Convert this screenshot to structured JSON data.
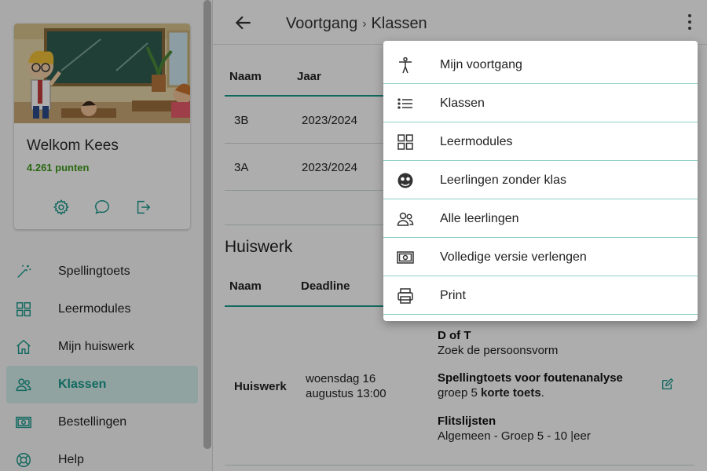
{
  "sidebar": {
    "welcome": "Welkom Kees",
    "points": "4.261 punten",
    "card_icons": [
      "gear-icon",
      "chat-icon",
      "logout-icon"
    ],
    "items": [
      {
        "label": "Spellingtoets",
        "icon": "magic-wand-icon"
      },
      {
        "label": "Leermodules",
        "icon": "grid-icon"
      },
      {
        "label": "Mijn huiswerk",
        "icon": "home-icon"
      },
      {
        "label": "Klassen",
        "icon": "people-icon",
        "active": true
      },
      {
        "label": "Bestellingen",
        "icon": "cash-icon"
      },
      {
        "label": "Help",
        "icon": "lifebuoy-icon"
      }
    ]
  },
  "header": {
    "breadcrumb": [
      "Voortgang",
      "Klassen"
    ],
    "separator": "›"
  },
  "classes_table": {
    "headers": [
      "Naam",
      "Jaar"
    ],
    "rows": [
      {
        "naam": "3B",
        "jaar": "2023/2024"
      },
      {
        "naam": "3A",
        "jaar": "2023/2024"
      }
    ]
  },
  "homework": {
    "title": "Huiswerk",
    "headers": [
      "Naam",
      "Deadline"
    ],
    "row": {
      "naam": "Huiswerk",
      "deadline_line1": "woensdag 16",
      "deadline_line2": "augustus 13:00",
      "assignments": [
        {
          "title": "D of T",
          "sub": "Zoek de persoonsvorm"
        },
        {
          "title": "Spellingtoets voor foutenanalyse",
          "sub_prefix": "groep 5 ",
          "sub_bold": "korte toets",
          "sub_suffix": "."
        },
        {
          "title": "Flitslijsten",
          "sub": "Algemeen - Groep 5 - 10 |eer"
        }
      ]
    }
  },
  "menu": {
    "items": [
      {
        "label": "Mijn voortgang",
        "icon": "person-icon"
      },
      {
        "label": "Klassen",
        "icon": "list-icon"
      },
      {
        "label": "Leermodules",
        "icon": "grid-icon"
      },
      {
        "label": "Leerlingen zonder klas",
        "icon": "face-icon"
      },
      {
        "label": "Alle leerlingen",
        "icon": "people-icon"
      },
      {
        "label": "Volledige versie verlengen",
        "icon": "cash-icon"
      },
      {
        "label": "Print",
        "icon": "printer-icon"
      }
    ]
  },
  "colors": {
    "accent": "#1a9a8c",
    "points": "#3d9a1a",
    "active_bg": "#d4f1ee"
  }
}
